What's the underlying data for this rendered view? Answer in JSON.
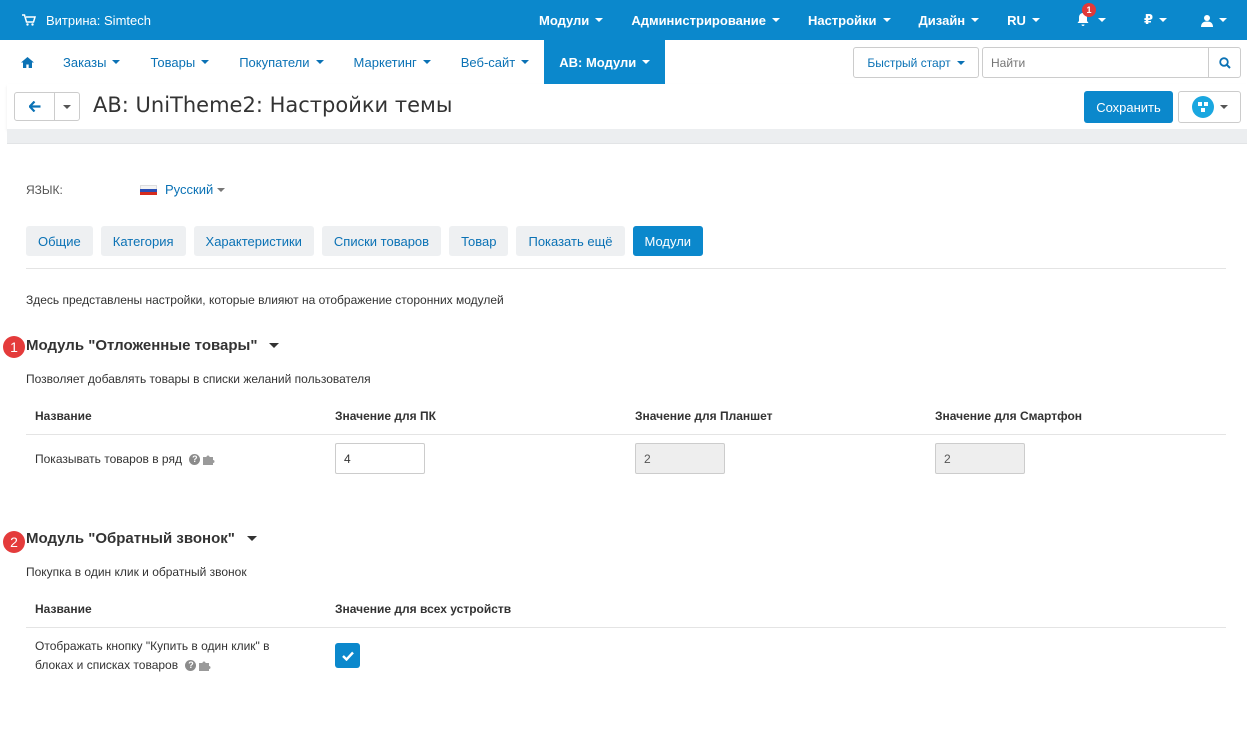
{
  "topbar": {
    "storefront": "Витрина: Simtech",
    "nav": [
      "Модули",
      "Администрирование",
      "Настройки",
      "Дизайн",
      "RU"
    ],
    "notifications_count": "1",
    "currency": "₽"
  },
  "subnav": {
    "items": [
      "Заказы",
      "Товары",
      "Покупатели",
      "Маркетинг",
      "Веб-сайт",
      "AB: Модули"
    ],
    "quick_start": "Быстрый старт",
    "search_placeholder": "Найти"
  },
  "page": {
    "title": "AB: UniTheme2: Настройки темы",
    "save_label": "Сохранить"
  },
  "language": {
    "label": "ЯЗЫК:",
    "selected": "Русский"
  },
  "tabs": [
    "Общие",
    "Категория",
    "Характеристики",
    "Списки товаров",
    "Товар",
    "Показать ещё",
    "Модули"
  ],
  "active_tab": "Модули",
  "intro": "Здесь представлены настройки, которые влияют на отображение сторонних модулей",
  "sections": [
    {
      "marker": "1",
      "title": "Модуль \"Отложенные товары\"",
      "description": "Позволяет добавлять товары в списки желаний пользователя",
      "headers": [
        "Название",
        "Значение для ПК",
        "Значение для Планшет",
        "Значение для Смартфон"
      ],
      "row": {
        "label": "Показывать товаров в ряд",
        "pc": "4",
        "tablet": "2",
        "phone": "2"
      }
    },
    {
      "marker": "2",
      "title": "Модуль \"Обратный звонок\"",
      "description": "Покупка в один клик и обратный звонок",
      "headers": [
        "Название",
        "Значение для всех устройств"
      ],
      "row": {
        "label_line1": "Отображать кнопку \"Купить в один клик\" в",
        "label_line2": "блоках и списках товаров",
        "checked": true
      }
    }
  ],
  "colors": {
    "primary": "#0b88cc",
    "link": "#0b72b5",
    "marker": "#e43b3b"
  }
}
